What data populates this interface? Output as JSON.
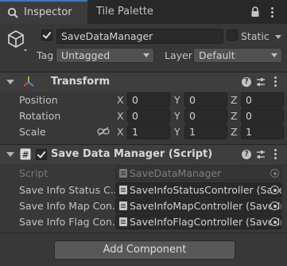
{
  "tabs": {
    "inspector": "Inspector",
    "tile_palette": "Tile Palette"
  },
  "gameobject": {
    "name": "SaveDataManager",
    "static_label": "Static",
    "tag_label": "Tag",
    "tag_value": "Untagged",
    "layer_label": "Layer",
    "layer_value": "Default",
    "active": true,
    "static": false
  },
  "transform": {
    "title": "Transform",
    "rows": [
      {
        "label": "Position",
        "x": "0",
        "y": "0",
        "z": "0"
      },
      {
        "label": "Rotation",
        "x": "0",
        "y": "0",
        "z": "0"
      },
      {
        "label": "Scale",
        "x": "1",
        "y": "1",
        "z": "1"
      }
    ],
    "axes": [
      "X",
      "Y",
      "Z"
    ]
  },
  "script_component": {
    "title": "Save Data Manager (Script)",
    "enabled": true,
    "script_label": "Script",
    "script_value": "SaveDataManager",
    "fields": [
      {
        "label": "Save Info Status C...",
        "value": "SaveInfoStatusController (Save"
      },
      {
        "label": "Save Info Map Con...",
        "value": "SaveInfoMapController (Save In"
      },
      {
        "label": "Save Info Flag Con...",
        "value": "SaveInfoFlagController (Save In"
      }
    ]
  },
  "add_component_label": "Add Component",
  "colors": {
    "background": "#383838",
    "accent": "#3a79bb",
    "transform_icon_red": "#e0483c",
    "transform_icon_green": "#7dc43d",
    "transform_icon_blue": "#3e8fe0"
  }
}
